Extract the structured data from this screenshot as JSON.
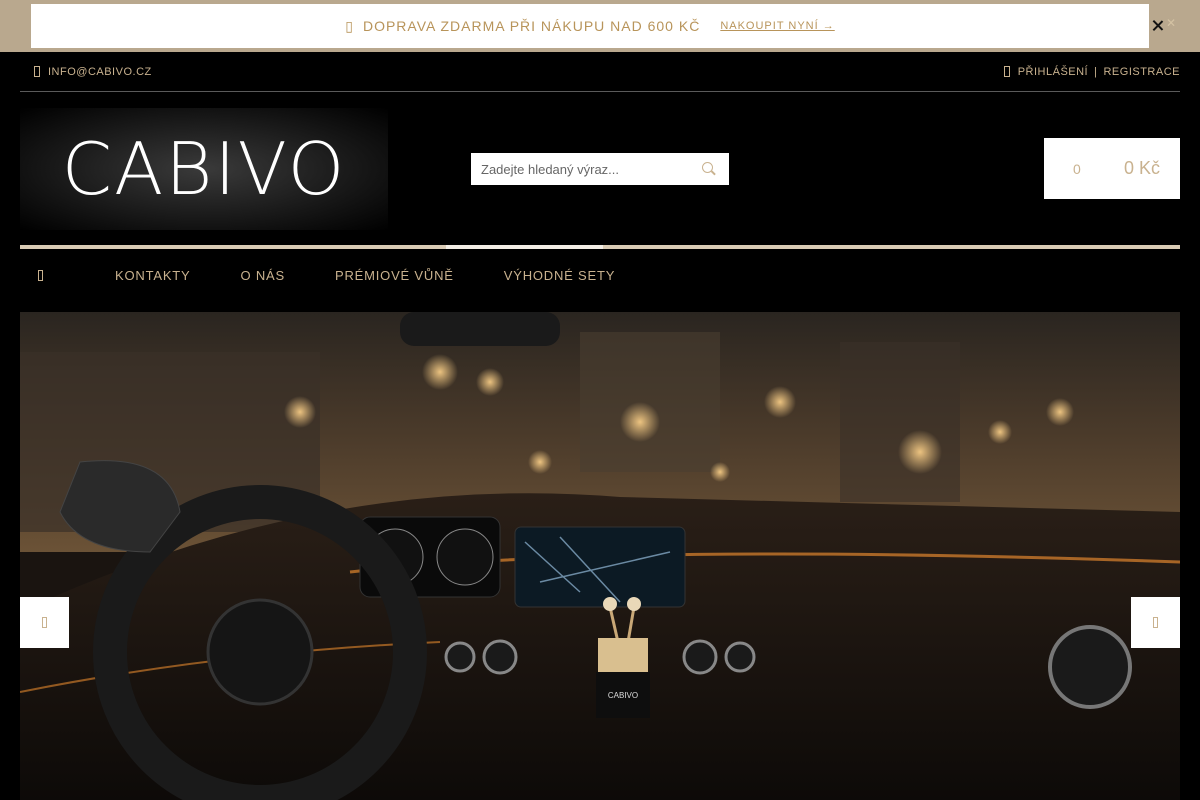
{
  "promo": {
    "text": "DOPRAVA ZDARMA PŘI NÁKUPU NAD 600 KČ",
    "link": "NAKOUPIT NYNÍ →",
    "icon": "truck-icon"
  },
  "topbar": {
    "email": "INFO@CABIVO.CZ",
    "login": "PŘIHLÁŠENÍ",
    "separator": "|",
    "register": "REGISTRACE"
  },
  "header": {
    "logo": "CABIVO",
    "search_placeholder": "Zadejte hledaný výraz...",
    "cart_count": "0",
    "cart_total": "0 Kč"
  },
  "nav": {
    "items": [
      {
        "label": "KONTAKTY"
      },
      {
        "label": "O NÁS"
      },
      {
        "label": "PRÉMIOVÉ VŮNĚ"
      },
      {
        "label": "VÝHODNÉ SETY"
      }
    ]
  },
  "hero": {
    "product_label": "CABIVO"
  },
  "colors": {
    "accent": "#c9b28f",
    "promo_bg": "#b9a88e",
    "page_bg": "#000000"
  }
}
